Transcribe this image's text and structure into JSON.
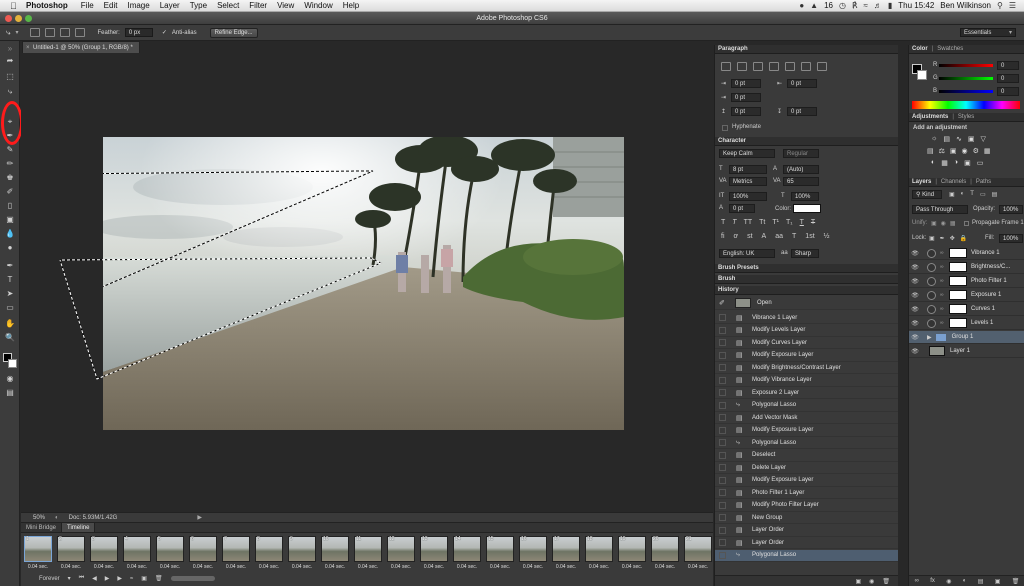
{
  "menubar": {
    "app": "Photoshop",
    "items": [
      "File",
      "Edit",
      "Image",
      "Layer",
      "Type",
      "Select",
      "Filter",
      "View",
      "Window",
      "Help"
    ],
    "status_number": "16",
    "clock": "Thu 15:42",
    "user": "Ben Wilkinson"
  },
  "title": "Adobe Photoshop CS6",
  "options": {
    "feather_label": "Feather:",
    "feather_value": "0 px",
    "antialias_label": "Anti-alias",
    "refine_edge": "Refine Edge...",
    "workspace": "Essentials"
  },
  "document": {
    "tab_title": "Untitled-1 @ 50% (Group 1, RGB/8) *",
    "zoom": "50%",
    "doc_info": "Doc: 5.93M/1.42G"
  },
  "timeline": {
    "tabs": [
      "Mini Bridge",
      "Timeline"
    ],
    "frames": [
      {
        "n": "1",
        "d": "0.04 sec."
      },
      {
        "n": "2",
        "d": "0.04 sec."
      },
      {
        "n": "3",
        "d": "0.04 sec."
      },
      {
        "n": "4",
        "d": "0.04 sec."
      },
      {
        "n": "5",
        "d": "0.04 sec."
      },
      {
        "n": "6",
        "d": "0.04 sec."
      },
      {
        "n": "7",
        "d": "0.04 sec."
      },
      {
        "n": "8",
        "d": "0.04 sec."
      },
      {
        "n": "9",
        "d": "0.04 sec."
      },
      {
        "n": "10",
        "d": "0.04 sec."
      },
      {
        "n": "11",
        "d": "0.04 sec."
      },
      {
        "n": "12",
        "d": "0.04 sec."
      },
      {
        "n": "13",
        "d": "0.04 sec."
      },
      {
        "n": "14",
        "d": "0.04 sec."
      },
      {
        "n": "15",
        "d": "0.04 sec."
      },
      {
        "n": "16",
        "d": "0.04 sec."
      },
      {
        "n": "17",
        "d": "0.04 sec."
      },
      {
        "n": "18",
        "d": "0.04 sec."
      },
      {
        "n": "19",
        "d": "0.04 sec."
      },
      {
        "n": "20",
        "d": "0.04 sec."
      },
      {
        "n": "21",
        "d": "0.04 sec."
      }
    ],
    "loop": "Forever"
  },
  "paragraph": {
    "title": "Paragraph",
    "fields": [
      "0 pt",
      "0 pt",
      "0 pt",
      "0 pt",
      "0 pt"
    ],
    "hyphenate": "Hyphenate"
  },
  "character": {
    "title": "Character",
    "font": "Keep Calm",
    "style": "Regular",
    "size": "8 pt",
    "leading": "(Auto)",
    "kerning": "Metrics",
    "tracking": "65",
    "vscale": "100%",
    "hscale": "100%",
    "baseline": "0 pt",
    "color_label": "Color:",
    "language": "English: UK",
    "aa": "Sharp"
  },
  "brush_presets": "Brush Presets",
  "brush": "Brush",
  "history": {
    "title": "History",
    "snapshot": "Open",
    "items": [
      "Vibrance 1 Layer",
      "Modify Levels Layer",
      "Modify Curves Layer",
      "Modify Exposure Layer",
      "Modify Brightness/Contrast Layer",
      "Modify Vibrance Layer",
      "Exposure 2 Layer",
      "Polygonal Lasso",
      "Add Vector Mask",
      "Modify Exposure Layer",
      "Polygonal Lasso",
      "Deselect",
      "Delete Layer",
      "Modify Exposure Layer",
      "Photo Filter 1 Layer",
      "Modify Photo Filter Layer",
      "New Group",
      "Layer Order",
      "Layer Order",
      "Polygonal Lasso"
    ]
  },
  "color_panel": {
    "tabs": [
      "Color",
      "Swatches"
    ],
    "r": "R",
    "g": "G",
    "b": "B",
    "rv": "0",
    "gv": "0",
    "bv": "0"
  },
  "adjustments": {
    "tabs": [
      "Adjustments",
      "Styles"
    ],
    "hint": "Add an adjustment"
  },
  "layers": {
    "tabs": [
      "Layers",
      "Channels",
      "Paths"
    ],
    "filter": "Kind",
    "blend": "Pass Through",
    "opacity_label": "Opacity:",
    "opacity": "100%",
    "unify": "Unify:",
    "propagate": "Propagate Frame 1",
    "lock": "Lock:",
    "fill_label": "Fill:",
    "fill": "100%",
    "items": [
      "Vibrance 1",
      "Brightness/C...",
      "Photo Filter 1",
      "Exposure 1",
      "Curves 1",
      "Levels 1",
      "Group 1",
      "Layer 1"
    ]
  },
  "colors": {
    "accent": "#52606f",
    "highlight_ring": "#ff1b1b"
  }
}
